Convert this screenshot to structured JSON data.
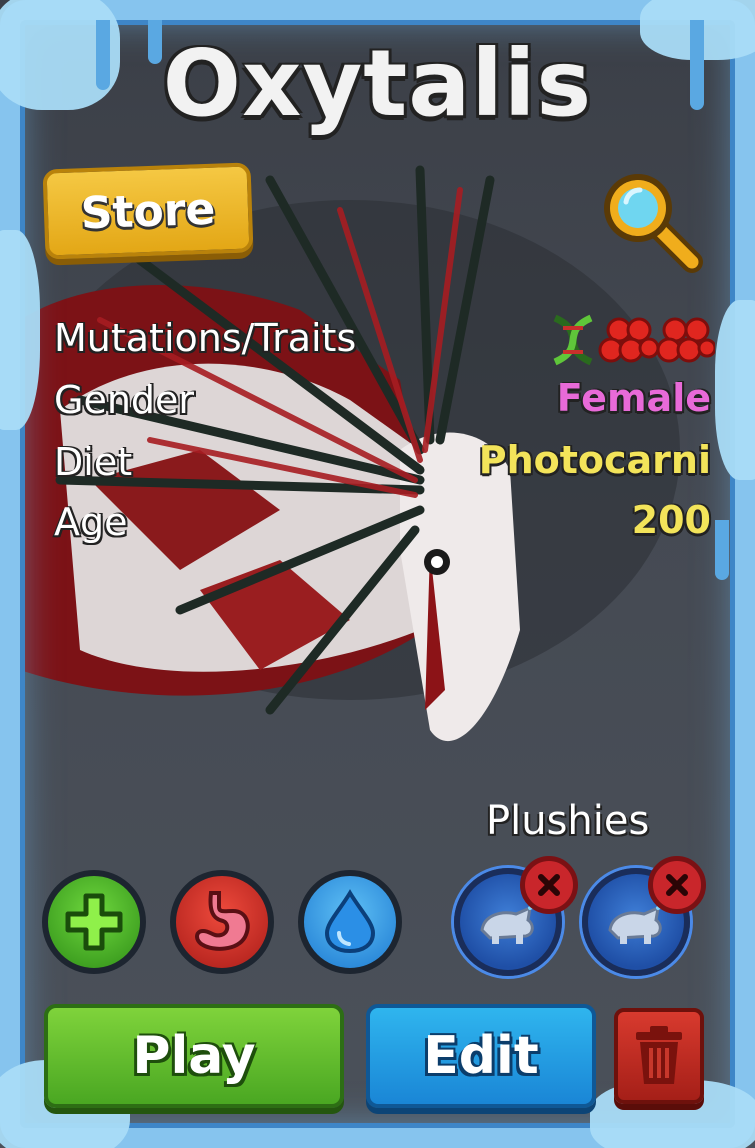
{
  "creature": {
    "name": "Oxytalis"
  },
  "store": {
    "label": "Store"
  },
  "stats": [
    {
      "label": "Mutations/Traits",
      "value": ""
    },
    {
      "label": "Gender",
      "value": "Female",
      "color": "#e86ad8"
    },
    {
      "label": "Diet",
      "value": "Photocarni",
      "color": "#f3e45a"
    },
    {
      "label": "Age",
      "value": "200",
      "color": "#f3e45a"
    }
  ],
  "traits": {
    "icons": [
      "dna-icon",
      "blood-cells-icon",
      "blood-cells-icon"
    ]
  },
  "needs": [
    {
      "name": "health-icon",
      "color": "#4dbd2c"
    },
    {
      "name": "stomach-icon",
      "color": "#d6312e"
    },
    {
      "name": "water-drop-icon",
      "color": "#2c9ae8"
    }
  ],
  "plushies": {
    "label": "Plushies",
    "slots": [
      {
        "icon": "plush-creature-icon",
        "remove_icon": "close-icon"
      },
      {
        "icon": "plush-creature-icon",
        "remove_icon": "close-icon"
      }
    ]
  },
  "actions": {
    "play_label": "Play",
    "edit_label": "Edit",
    "delete_icon": "trash-icon"
  },
  "colors": {
    "frame": "#86c4ee",
    "store": "#e3a716",
    "play": "#4aa722",
    "edit": "#1a86d6",
    "delete": "#c0291f"
  }
}
